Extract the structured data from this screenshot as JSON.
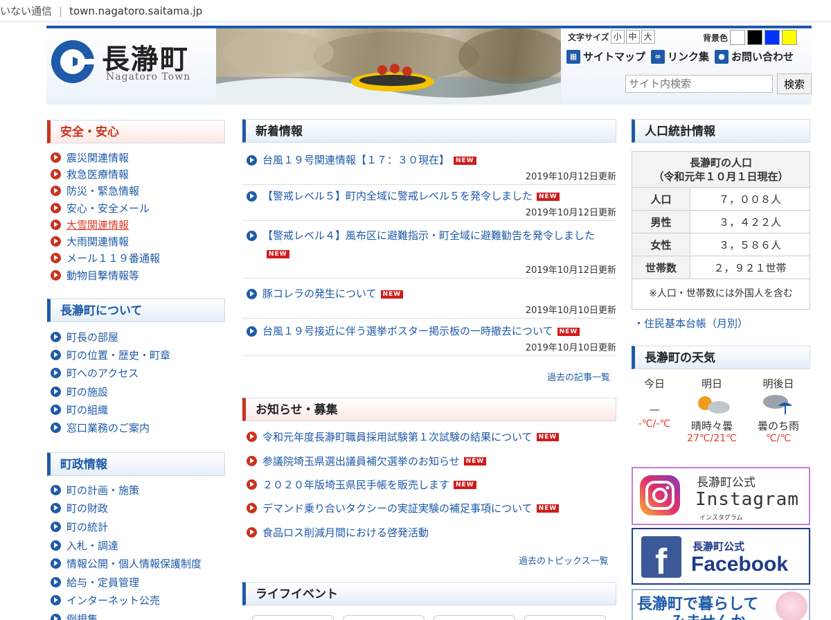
{
  "browser": {
    "security": "いない通信",
    "url": "town.nagatoro.saitama.jp"
  },
  "header": {
    "logo_ja": "長瀞町",
    "logo_en": "Nagatoro Town",
    "font_size_label": "文字サイズ",
    "font_sizes": [
      "小",
      "中",
      "大"
    ],
    "bg_color_label": "背景色",
    "bg_colors": [
      "#ffffff",
      "#000000",
      "#0033ff",
      "#ffff00"
    ],
    "links": [
      "サイトマップ",
      "リンク集",
      "お問い合わせ"
    ],
    "search_placeholder": "サイト内検索",
    "search_button": "検索"
  },
  "left": {
    "safety": {
      "title": "安全・安心",
      "items": [
        "震災関連情報",
        "救急医療情報",
        "防災・緊急情報",
        "安心・安全メール",
        "大雪関連情報",
        "大雨関連情報",
        "メール１１９番通報",
        "動物目撃情報等"
      ]
    },
    "about": {
      "title": "長瀞町について",
      "items": [
        "町長の部屋",
        "町の位置・歴史・町章",
        "町へのアクセス",
        "町の施設",
        "町の組織",
        "窓口業務のご案内"
      ]
    },
    "admin": {
      "title": "町政情報",
      "items": [
        "町の計画・施策",
        "町の財政",
        "町の統計",
        "入札・調達",
        "情報公開・個人情報保護制度",
        "給与・定員管理",
        "インターネット公売",
        "例規集"
      ]
    }
  },
  "center": {
    "news_title": "新着情報",
    "new_badge": "NEW",
    "news": [
      {
        "text": "台風１９号関連情報【１７：３０現在】",
        "date": "2019年10月12日更新"
      },
      {
        "text": "【警戒レベル５】町内全域に警戒レベル５を発令しました",
        "date": "2019年10月12日更新"
      },
      {
        "text": "【警戒レベル４】風布区に避難指示・町全域に避難勧告を発令しました",
        "date": "2019年10月12日更新"
      },
      {
        "text": "豚コレラの発生について",
        "date": "2019年10月10日更新"
      },
      {
        "text": "台風１９号接近に伴う選挙ポスター掲示板の一時撤去について",
        "date": "2019年10月10日更新"
      }
    ],
    "news_more": "過去の記事一覧",
    "notice_title": "お知らせ・募集",
    "notices": [
      "令和元年度長瀞町職員採用試験第１次試験の結果について",
      "参議院埼玉県選出議員補欠選挙のお知らせ",
      "２０２０年版埼玉県民手帳を販売します",
      "デマンド乗り合いタクシーの実証実験の補足事項について",
      "食品ロス削減月間における啓発活動"
    ],
    "notices_new": [
      true,
      true,
      true,
      true,
      false
    ],
    "notice_more": "過去のトピックス一覧",
    "life_title": "ライフイベント"
  },
  "right": {
    "pop_title": "人口統計情報",
    "pop_caption1": "長瀞町の人口",
    "pop_caption2": "（令和元年１０月１日現在）",
    "pop_rows": [
      {
        "k": "人口",
        "v": "７，００８人"
      },
      {
        "k": "男性",
        "v": "３，４２２人"
      },
      {
        "k": "女性",
        "v": "３，５８６人"
      },
      {
        "k": "世帯数",
        "v": "２，９２１世帯"
      }
    ],
    "pop_note": "※人口・世帯数には外国人を含む",
    "pop_link": "・住民基本台帳（月別）",
    "weather_title": "長瀞町の天気",
    "weather": [
      {
        "day": "今日",
        "desc": "—",
        "temp": "-℃/-℃"
      },
      {
        "day": "明日",
        "desc": "晴時々曇",
        "temp": "27℃/21℃"
      },
      {
        "day": "明後日",
        "desc": "曇のち雨",
        "temp": "℃/℃"
      }
    ],
    "insta_l1": "長瀞町公式",
    "insta_l2": "Instagram",
    "insta_l3": "インスタグラム",
    "fb_l1": "長瀞町公式",
    "fb_l2": "Facebook",
    "live_l1": "長瀞町で暮らして",
    "live_l2": "みませんか"
  }
}
